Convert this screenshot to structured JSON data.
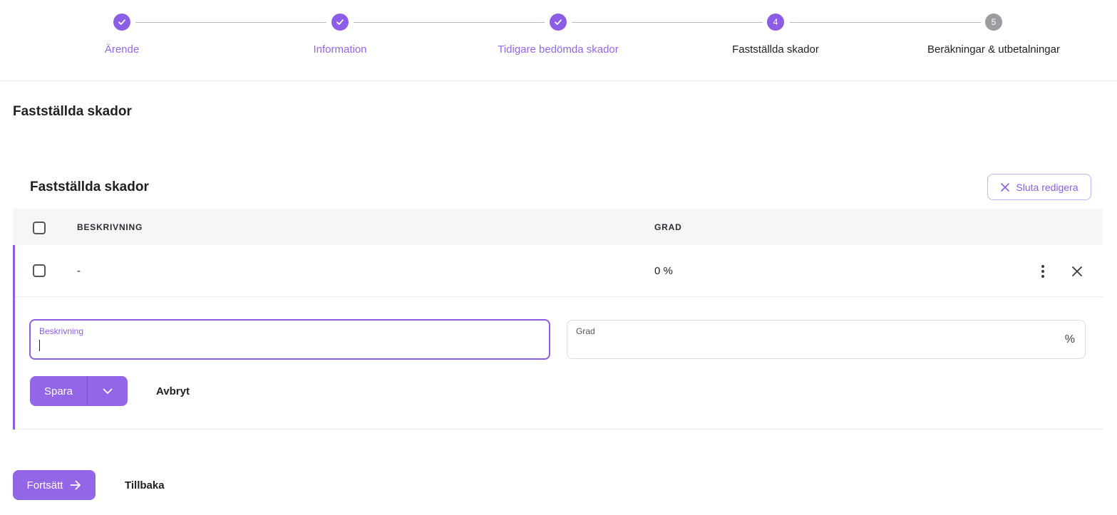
{
  "stepper": {
    "steps": [
      {
        "label": "Ärende",
        "state": "done",
        "number": ""
      },
      {
        "label": "Information",
        "state": "done",
        "number": ""
      },
      {
        "label": "Tidigare bedömda skador",
        "state": "done",
        "number": ""
      },
      {
        "label": "Fastställda skador",
        "state": "active",
        "number": "4"
      },
      {
        "label": "Beräkningar & utbetalningar",
        "state": "pending",
        "number": "5"
      }
    ]
  },
  "page": {
    "title": "Fastställda skador"
  },
  "card": {
    "title": "Fastställda skador",
    "stop_edit_label": "Sluta redigera"
  },
  "table": {
    "columns": {
      "description": "BESKRIVNING",
      "grade": "GRAD"
    },
    "rows": [
      {
        "description": "-",
        "grade": "0 %"
      }
    ]
  },
  "form": {
    "description_label": "Beskrivning",
    "description_value": "",
    "grade_label": "Grad",
    "grade_value": "",
    "grade_suffix": "%",
    "save_label": "Spara",
    "cancel_label": "Avbryt"
  },
  "footer": {
    "continue_label": "Fortsätt",
    "back_label": "Tillbaka"
  },
  "colors": {
    "accent": "#8c5ee6",
    "accent_button": "#9366e8",
    "pending_step": "#9b9ba0"
  }
}
